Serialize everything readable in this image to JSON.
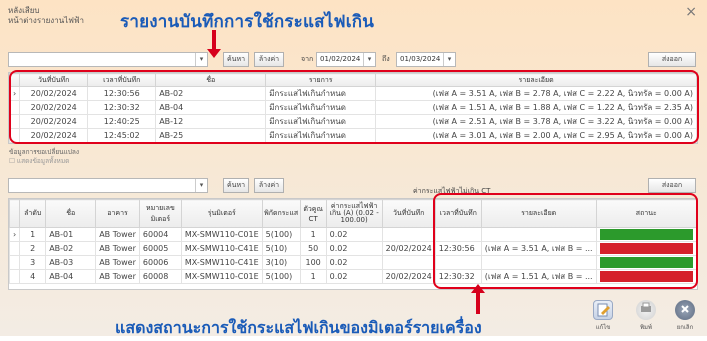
{
  "window": {
    "title_line1": "หลังเสียบ",
    "title_line2": "หน้าต่างรายงานไฟฟ้า",
    "close": "×"
  },
  "headline": "รายงานบันทึกการใช้กระแสไฟเกิน",
  "bottom_caption": "แสดงสถานะการใช้กระแสไฟเกินของมิเตอร์รายเครื่อง",
  "top_toolbar": {
    "search_button": "ค้นหา",
    "clear_button": "ล้างค่า",
    "from_label": "จาก",
    "from_date": "01/02/2024",
    "to_label": "ถึง",
    "to_date": "01/03/2024",
    "export_button": "ส่งออก"
  },
  "top_table": {
    "headers": [
      "วันที่บันทึก",
      "เวลาที่บันทึก",
      "ชื่อ",
      "รายการ",
      "รายละเอียด"
    ],
    "rows": [
      [
        "20/02/2024",
        "12:30:56",
        "AB-02",
        "มีกระแสไฟเกินกำหนด",
        "(เฟส A = 3.51 A, เฟส B = 2.78 A, เฟส C = 2.22 A, นิวทรัล = 0.00 A)"
      ],
      [
        "20/02/2024",
        "12:30:32",
        "AB-04",
        "มีกระแสไฟเกินกำหนด",
        "(เฟส A = 1.51 A, เฟส B = 1.88 A, เฟส C = 1.22 A, นิวทรัล = 2.35 A)"
      ],
      [
        "20/02/2024",
        "12:40:25",
        "AB-12",
        "มีกระแสไฟเกินกำหนด",
        "(เฟส A = 2.51 A, เฟส B = 3.78 A, เฟส C = 3.22 A, นิวทรัล = 0.00 A)"
      ],
      [
        "20/02/2024",
        "12:45:02",
        "AB-25",
        "มีกระแสไฟเกินกำหนด",
        "(เฟส A = 3.01 A, เฟส B = 2.00 A, เฟส C = 2.95 A, นิวทรัล = 0.00 A)"
      ]
    ]
  },
  "section_label": "ข้อมูลการขอเปลี่ยนแปลง",
  "checkbox_label": "แสดงข้อมูลทั้งหมด",
  "bottom_toolbar": {
    "search_button": "ค้นหา",
    "clear_button": "ล้างค่า",
    "caption": "ค่ากระแสไฟฟ้าไม่เกิน CT",
    "export_button": "ส่งออก"
  },
  "bottom_table": {
    "headers": [
      "ลำดับ",
      "ชื่อ",
      "อาคาร",
      "หมายเลขมิเตอร์",
      "รุ่นมิเตอร์",
      "พิกัดกระแส",
      "ตัวคูณ CT",
      "ค่ากระแสไฟฟ้าเกิน (A) (0.02 - 100.00)",
      "วันที่บันทึก",
      "เวลาที่บันทึก",
      "รายละเอียด",
      "สถานะ"
    ],
    "rows": [
      [
        "1",
        "AB-01",
        "AB Tower",
        "60004",
        "MX-SMW110-C01E",
        "5(100)",
        "1",
        "0.02",
        "",
        "",
        "",
        "ok"
      ],
      [
        "2",
        "AB-02",
        "AB Tower",
        "60005",
        "MX-SMW110-C41E",
        "5(10)",
        "50",
        "0.02",
        "20/02/2024",
        "12:30:56",
        "(เฟส A = 3.51 A, เฟส B = ...",
        "bad"
      ],
      [
        "3",
        "AB-03",
        "AB Tower",
        "60006",
        "MX-SMW110-C41E",
        "3(10)",
        "100",
        "0.02",
        "",
        "",
        "",
        "ok"
      ],
      [
        "4",
        "AB-04",
        "AB Tower",
        "60008",
        "MX-SMW110-C01E",
        "5(100)",
        "1",
        "0.02",
        "20/02/2024",
        "12:30:32",
        "(เฟส A = 1.51 A, เฟส B = ...",
        "bad"
      ]
    ]
  },
  "bottom_buttons": {
    "edit": "แก้ไข",
    "print": "พิมพ์",
    "cancel": "ยกเลิก"
  },
  "colors": {
    "accent": "#1a5bb8",
    "highlight_frame": "#e0001b",
    "status_ok": "#2c9a2c",
    "status_bad": "#d5202b"
  }
}
